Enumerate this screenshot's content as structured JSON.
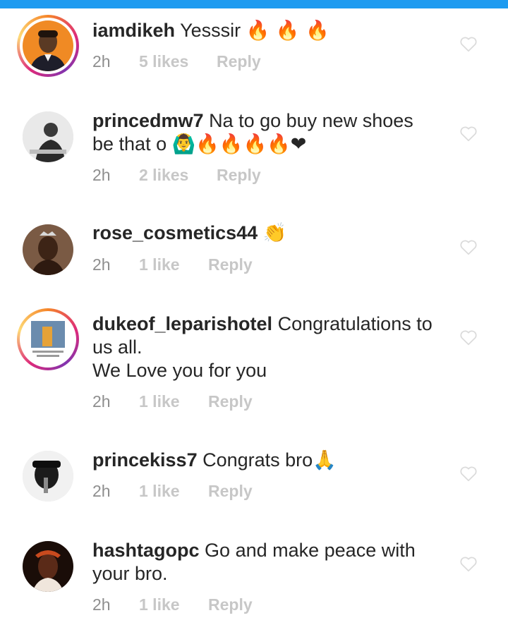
{
  "colors": {
    "accent_bar": "#1e9bf0",
    "text": "#262626",
    "muted": "#8e8e8e",
    "faint": "#c7c7c7"
  },
  "comments": [
    {
      "username": "iamdikeh",
      "body": "Yesssir",
      "emoji": "🔥 🔥 🔥",
      "time": "2h",
      "likes": "5 likes",
      "reply": "Reply",
      "has_story_ring": true,
      "icon": "heart-outline-icon"
    },
    {
      "username": "princedmw7",
      "body": "Na to go buy new shoes be that o",
      "emoji": "🙆‍♂️🔥🔥🔥🔥❤",
      "time": "2h",
      "likes": "2 likes",
      "reply": "Reply",
      "has_story_ring": false,
      "icon": "heart-outline-icon"
    },
    {
      "username": "rose_cosmetics44",
      "body": "",
      "emoji": "👏",
      "time": "2h",
      "likes": "1 like",
      "reply": "Reply",
      "has_story_ring": false,
      "icon": "heart-outline-icon"
    },
    {
      "username": "dukeof_leparishotel",
      "body": "Congratulations to us all.",
      "body2": "We Love you for you",
      "emoji": "",
      "time": "2h",
      "likes": "1 like",
      "reply": "Reply",
      "has_story_ring": true,
      "icon": "heart-outline-icon"
    },
    {
      "username": "princekiss7",
      "body": "Congrats bro",
      "emoji": "🙏",
      "time": "2h",
      "likes": "1 like",
      "reply": "Reply",
      "has_story_ring": false,
      "icon": "heart-outline-icon"
    },
    {
      "username": "hashtagopc",
      "body": "Go and make peace with your bro.",
      "emoji": "",
      "time": "2h",
      "likes": "1 like",
      "reply": "Reply",
      "has_story_ring": false,
      "icon": "heart-outline-icon"
    }
  ]
}
